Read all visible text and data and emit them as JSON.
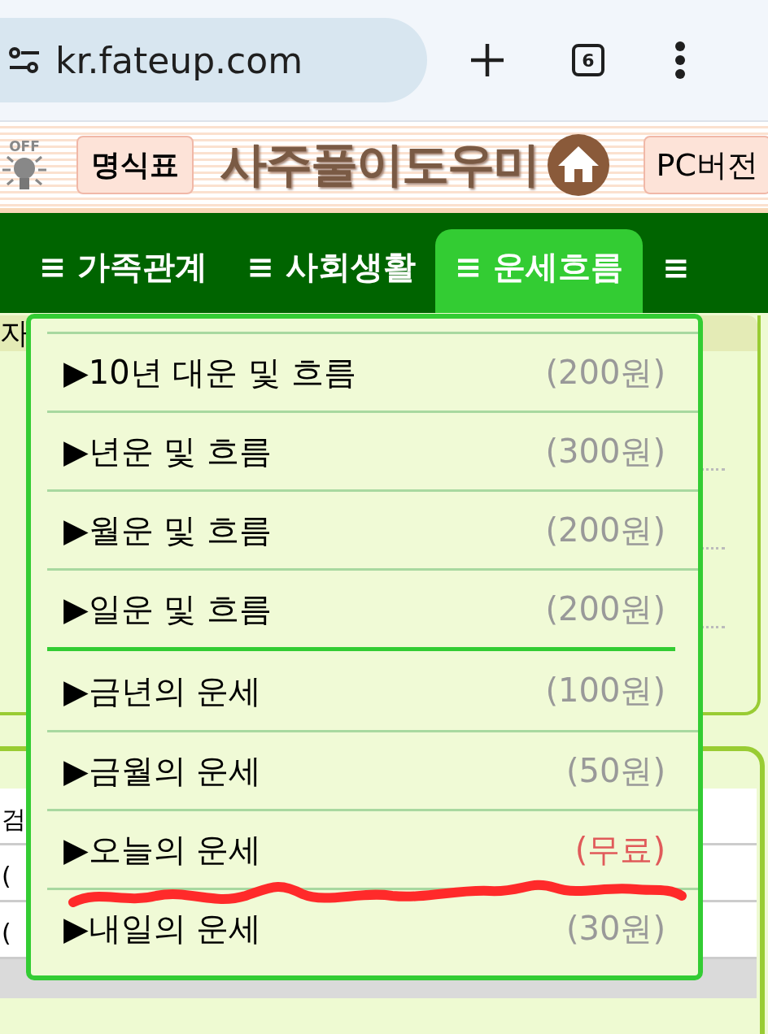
{
  "browser": {
    "address": "kr.fateup.com",
    "tab_count": "6"
  },
  "header": {
    "light_label": "OFF",
    "card_button": "명식표",
    "logo_text": "사주풀이도우미",
    "pc_button": "PC버전"
  },
  "nav": [
    {
      "label": "≡ 가족관계",
      "selected": false
    },
    {
      "label": "≡ 사회생활",
      "selected": false
    },
    {
      "label": "≡ 운세흐름",
      "selected": true
    },
    {
      "label": "≡",
      "selected": false
    }
  ],
  "background": {
    "panel_header": "자",
    "table_cells": [
      "검",
      "(",
      "("
    ]
  },
  "menu": {
    "groups": [
      [
        {
          "label": "▶10년 대운 및 흐름",
          "price": "(200원)",
          "kind": "paid"
        },
        {
          "label": "▶년운 및 흐름",
          "price": "(300원)",
          "kind": "paid"
        },
        {
          "label": "▶월운 및 흐름",
          "price": "(200원)",
          "kind": "paid"
        },
        {
          "label": "▶일운 및 흐름",
          "price": "(200원)",
          "kind": "paid"
        }
      ],
      [
        {
          "label": "▶금년의 운세",
          "price": "(100원)",
          "kind": "paid"
        },
        {
          "label": "▶금월의 운세",
          "price": "(50원)",
          "kind": "paid"
        },
        {
          "label": "▶오늘의 운세",
          "price": "(무료)",
          "kind": "free"
        },
        {
          "label": "▶내일의 운세",
          "price": "(30원)",
          "kind": "paid"
        }
      ]
    ]
  }
}
